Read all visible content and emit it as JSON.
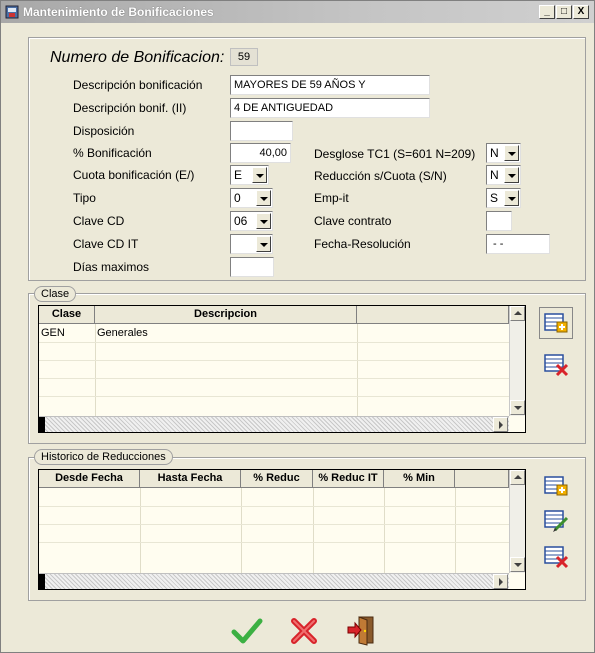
{
  "window": {
    "title": "Mantenimiento de Bonificaciones",
    "minimize": "_",
    "maximize": "□",
    "close": "X"
  },
  "header": {
    "title": "Numero de Bonificacion:",
    "number": "59"
  },
  "fields": {
    "descripcion_label": "Descripción  bonificación",
    "descripcion_value": "MAYORES DE 59 AÑOS Y",
    "descripcion2_label": "Descripción bonif. (II)",
    "descripcion2_value": "4 DE ANTIGUEDAD",
    "disposicion_label": "Disposición",
    "disposicion_value": "",
    "pct_label": "% Bonificación",
    "pct_value": "40,00",
    "cuota_label": "Cuota bonificación (E/)",
    "cuota_value": "E",
    "tipo_label": "Tipo",
    "tipo_value": "0",
    "clave_cd_label": "Clave CD",
    "clave_cd_value": "06",
    "clave_cd_it_label": "Clave CD IT",
    "clave_cd_it_value": "",
    "dias_label": "Días maximos",
    "dias_value": "",
    "desglose_label": "Desglose  TC1 (S=601 N=209)",
    "desglose_value": "N",
    "reduccion_label": "Reducción s/Cuota (S/N)",
    "reduccion_value": "N",
    "empit_label": "Emp-it",
    "empit_value": "S",
    "clave_contrato_label": "Clave contrato",
    "clave_contrato_value": "",
    "fecha_res_label": "Fecha-Resolución",
    "fecha_res_value": "- -"
  },
  "clase": {
    "group_label": "Clase",
    "columns": [
      "Clase",
      "Descripcion",
      ""
    ],
    "rows": [
      {
        "clase": "GEN",
        "descripcion": "Generales"
      }
    ]
  },
  "historico": {
    "group_label": "Historico de Reducciones",
    "columns": [
      "Desde Fecha",
      "Hasta Fecha",
      "% Reduc",
      "% Reduc IT",
      "% Min",
      ""
    ]
  },
  "icons": {
    "add": "add-record-icon",
    "edit": "edit-record-icon",
    "delete": "delete-record-icon",
    "accept": "checkmark-icon",
    "cancel": "cancel-x-icon",
    "exit": "exit-door-icon"
  },
  "colors": {
    "accept": "#3cb043",
    "cancel": "#d8232a",
    "grid_bg": "#fffdf0"
  }
}
